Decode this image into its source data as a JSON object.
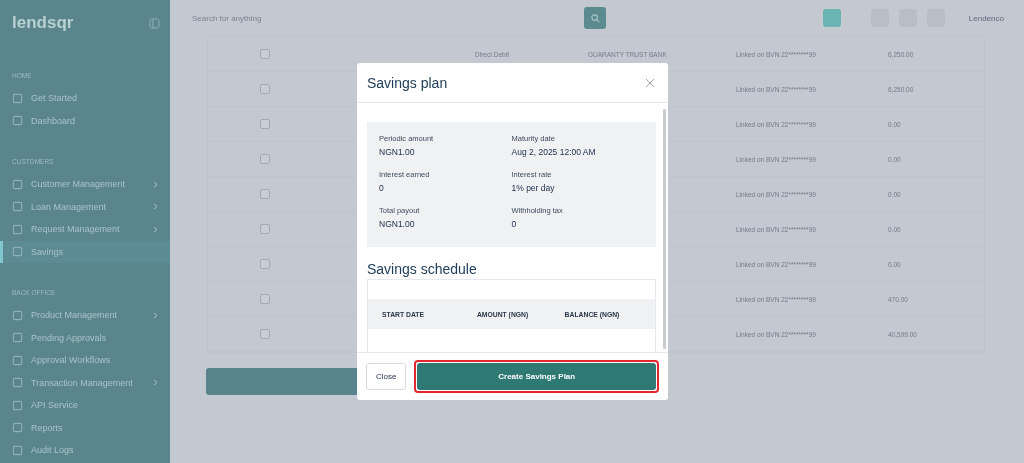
{
  "sidebar": {
    "brand": "lendsqr",
    "sections": [
      {
        "title": "HOME",
        "items": [
          {
            "label": "Get Started",
            "has_submenu": false,
            "selected": false
          },
          {
            "label": "Dashboard",
            "has_submenu": false,
            "selected": false
          }
        ]
      },
      {
        "title": "CUSTOMERS",
        "items": [
          {
            "label": "Customer Management",
            "has_submenu": true,
            "selected": false
          },
          {
            "label": "Loan Management",
            "has_submenu": true,
            "selected": false
          },
          {
            "label": "Request Management",
            "has_submenu": true,
            "selected": false
          },
          {
            "label": "Savings",
            "has_submenu": false,
            "selected": true
          }
        ]
      },
      {
        "title": "BACK OFFICE",
        "items": [
          {
            "label": "Product Management",
            "has_submenu": true,
            "selected": false
          },
          {
            "label": "Pending Approvals",
            "has_submenu": false,
            "selected": false
          },
          {
            "label": "Approval Workflows",
            "has_submenu": false,
            "selected": false
          },
          {
            "label": "Transaction Management",
            "has_submenu": true,
            "selected": false
          },
          {
            "label": "API Service",
            "has_submenu": false,
            "selected": false
          },
          {
            "label": "Reports",
            "has_submenu": false,
            "selected": false
          },
          {
            "label": "Audit Logs",
            "has_submenu": false,
            "selected": false
          }
        ]
      }
    ]
  },
  "topbar": {
    "search": {
      "placeholder": "Search for anything"
    },
    "user": "Lendenco"
  },
  "table": {
    "rows": [
      {
        "checked": false,
        "type": "Direct Debit",
        "bank": "GUARANTY TRUST BANK",
        "linked": "Linked on BVN 22********99",
        "amount": "6,250.00"
      },
      {
        "checked": false,
        "linked": "Linked on BVN 22********99",
        "amount": "6,250.00"
      },
      {
        "checked": false,
        "linked": "Linked on BVN 22********99",
        "amount": "0.00"
      },
      {
        "checked": false,
        "linked": "Linked on BVN 22********99",
        "amount": "0.00"
      },
      {
        "checked": false,
        "linked": "Linked on BVN 22********99",
        "amount": "0.00"
      },
      {
        "checked": false,
        "linked": "Linked on BVN 22********99",
        "amount": "0.00"
      },
      {
        "checked": false,
        "linked": "Linked on BVN 22********99",
        "amount": "0.00"
      },
      {
        "checked": false,
        "linked": "Linked on BVN 22********99",
        "amount": "470.00"
      },
      {
        "checked": false,
        "linked": "Linked on BVN 22********99",
        "amount": "40,599.00"
      }
    ]
  },
  "modal": {
    "title": "Savings plan",
    "summary": [
      {
        "label": "Periodic amount",
        "value": "NGN1.00"
      },
      {
        "label": "Maturity date",
        "value": "Aug 2, 2025 12:00 AM"
      },
      {
        "label": "Interest earned",
        "value": "0"
      },
      {
        "label": "Interest rate",
        "value": "1% per day"
      },
      {
        "label": "Total payout",
        "value": "NGN1.00"
      },
      {
        "label": "Withholding tax",
        "value": "0"
      }
    ],
    "schedule": {
      "title": "Savings schedule",
      "columns": [
        "START DATE",
        "AMOUNT (NGN)",
        "BALANCE (NGN)"
      ]
    },
    "buttons": [
      {
        "label": "Close",
        "kind": "secondary",
        "highlighted": false
      },
      {
        "label": "Create Savings Plan",
        "kind": "primary",
        "highlighted": true
      }
    ]
  }
}
